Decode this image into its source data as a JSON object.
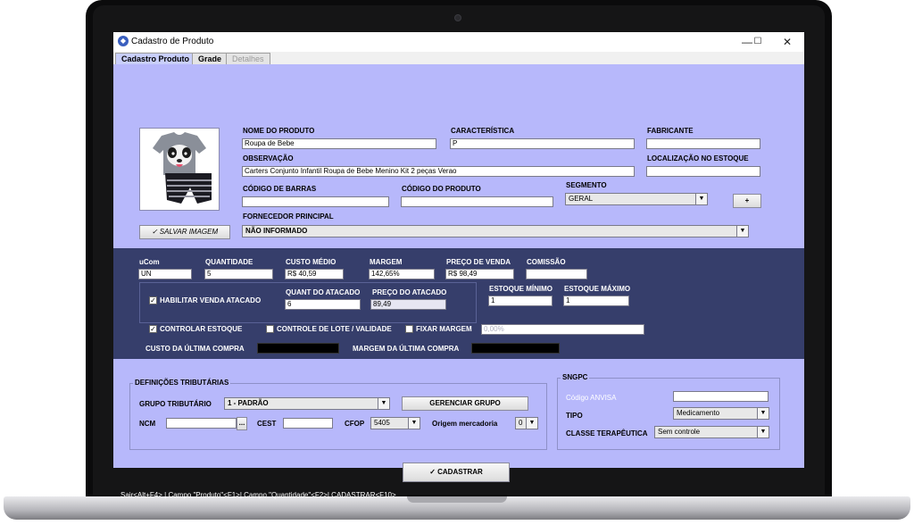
{
  "window": {
    "title": "Cadastro de Produto",
    "minimize": "—",
    "maximize": "☐",
    "close": "✕"
  },
  "tabs": [
    {
      "label": "Cadastro Produto",
      "state": "active"
    },
    {
      "label": "Grade",
      "state": "normal"
    },
    {
      "label": "Detalhes",
      "state": "disabled"
    }
  ],
  "product": {
    "save_image_label": "SALVAR IMAGEM",
    "nome_label": "NOME DO PRODUTO",
    "nome_value": "Roupa de Bebe",
    "caracteristica_label": "CARACTERÍSTICA",
    "caracteristica_value": "P",
    "fabricante_label": "FABRICANTE",
    "fabricante_value": "",
    "observacao_label": "OBSERVAÇÃO",
    "observacao_value": "Carters Conjunto Infantil Roupa de Bebe Menino Kit 2 peças Verao",
    "localizacao_label": "LOCALIZAÇÃO NO ESTOQUE",
    "localizacao_value": "",
    "codigo_barras_label": "CÓDIGO DE BARRAS",
    "codigo_barras_value": "",
    "codigo_produto_label": "CÓDIGO DO PRODUTO",
    "codigo_produto_value": "",
    "segmento_label": "SEGMENTO",
    "segmento_value": "GERAL",
    "add_segment_label": "+",
    "fornecedor_label": "FORNECEDOR PRINCIPAL",
    "fornecedor_value": "NÃO INFORMADO"
  },
  "pricing": {
    "ucom_label": "uCom",
    "ucom_value": "UN",
    "quantidade_label": "QUANTIDADE",
    "quantidade_value": "5",
    "custo_medio_label": "CUSTO MÉDIO",
    "custo_medio_value": "R$ 40,59",
    "margem_label": "MARGEM",
    "margem_value": "142,65%",
    "preco_venda_label": "PREÇO DE VENDA",
    "preco_venda_value": "R$ 98,49",
    "comissao_label": "COMISSÃO",
    "comissao_value": "",
    "atacado_label": "HABILITAR VENDA ATACADO",
    "quant_atacado_label": "QUANT DO ATACADO",
    "quant_atacado_value": "6",
    "preco_atacado_label": "PREÇO DO ATACADO",
    "preco_atacado_value": "89,49",
    "estoque_min_label": "ESTOQUE MÍNIMO",
    "estoque_min_value": "1",
    "estoque_max_label": "ESTOQUE MÁXIMO",
    "estoque_max_value": "1",
    "controlar_estoque_label": "CONTROLAR ESTOQUE",
    "controle_lote_label": "CONTROLE DE LOTE / VALIDADE",
    "fixar_margem_label": "FIXAR MARGEM",
    "fixar_margem_value": "0,00%",
    "custo_ultima_label": "CUSTO DA ÚLTIMA COMPRA",
    "margem_ultima_label": "MARGEM DA ÚLTIMA COMPRA",
    "check_mark": "✓"
  },
  "tributaria": {
    "title": "DEFINIÇÕES TRIBUTÁRIAS",
    "grupo_label": "GRUPO TRIBUTÁRIO",
    "grupo_value": "1 - PADRÃO",
    "gerenciar_label": "GERENCIAR GRUPO",
    "ncm_label": "NCM",
    "ncm_value": "",
    "ncm_button": "...",
    "cest_label": "CEST",
    "cest_value": "",
    "cfop_label": "CFOP",
    "cfop_value": "5405",
    "origem_label": "Origem mercadoria",
    "origem_value": "0"
  },
  "sngpc": {
    "title": "SNGPC",
    "anvisa_label": "Código ANVISA",
    "anvisa_value": "",
    "tipo_label": "TIPO",
    "tipo_value": "Medicamento",
    "classe_label": "CLASSE TERAPÊUTICA",
    "classe_value": "Sem controle"
  },
  "actions": {
    "cadastrar_label": "CADASTRAR"
  },
  "status_bar": "Sair<Alt+F4> | Campo \"Produto\"<F1>| Campo \"Quantidade\"<F2>| CADASTRAR<F10>",
  "colors": {
    "background": "#b7b8fb",
    "pricing_panel": "#363e6b",
    "active_tab": "#c9cffb"
  }
}
